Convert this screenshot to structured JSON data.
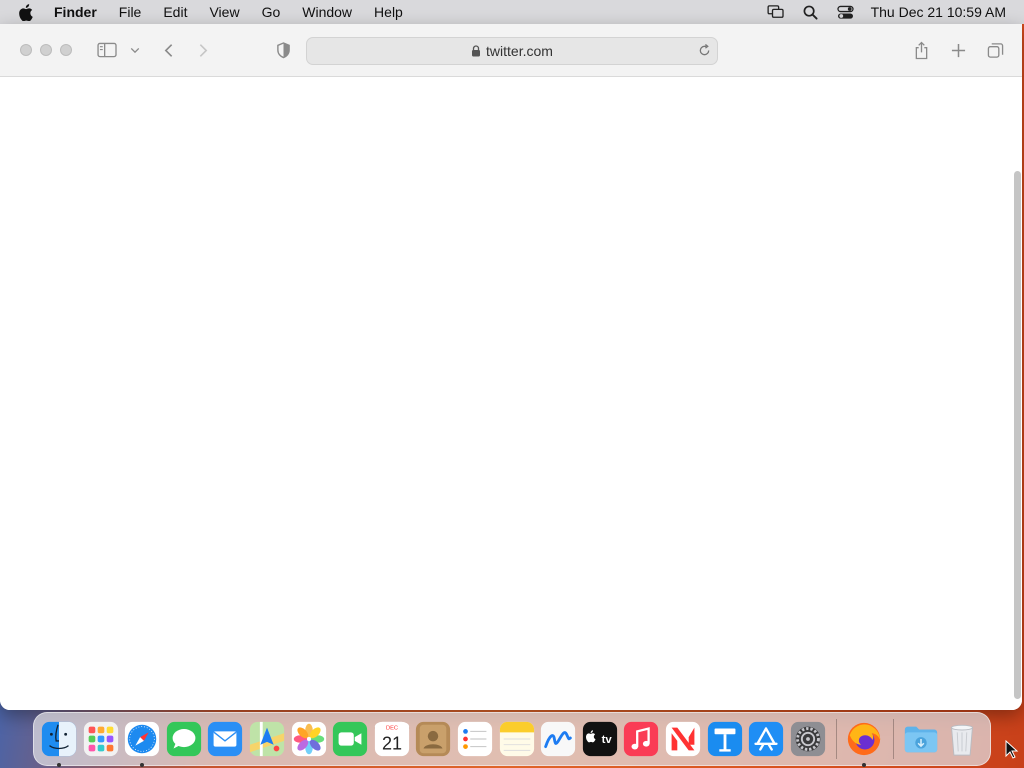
{
  "menubar": {
    "apple_icon": "apple-logo-icon",
    "items": [
      {
        "label": "Finder",
        "bold": true
      },
      {
        "label": "File"
      },
      {
        "label": "Edit"
      },
      {
        "label": "View"
      },
      {
        "label": "Go"
      },
      {
        "label": "Window"
      },
      {
        "label": "Help"
      }
    ],
    "status_icons": [
      "screen-mirroring-icon",
      "spotlight-search-icon",
      "control-center-icon"
    ],
    "clock": "Thu Dec 21  10:59 AM"
  },
  "browser": {
    "url": "twitter.com",
    "toolbar_icons": [
      "sidebar-icon",
      "chevron-down-icon",
      "back-icon",
      "forward-icon",
      "privacy-shield-icon",
      "share-icon",
      "new-tab-icon",
      "tab-overview-icon"
    ]
  },
  "dock": {
    "apps": [
      {
        "name": "Finder",
        "icon": "finder-icon",
        "running": true
      },
      {
        "name": "Launchpad",
        "icon": "launchpad-icon",
        "running": false
      },
      {
        "name": "Safari",
        "icon": "safari-icon",
        "running": true
      },
      {
        "name": "Messages",
        "icon": "messages-icon",
        "running": false
      },
      {
        "name": "Mail",
        "icon": "mail-icon",
        "running": false
      },
      {
        "name": "Maps",
        "icon": "maps-icon",
        "running": false
      },
      {
        "name": "Photos",
        "icon": "photos-icon",
        "running": false
      },
      {
        "name": "FaceTime",
        "icon": "facetime-icon",
        "running": false
      },
      {
        "name": "Calendar",
        "icon": "calendar-icon",
        "running": false,
        "month": "DEC",
        "day": "21"
      },
      {
        "name": "Contacts",
        "icon": "contacts-icon",
        "running": false
      },
      {
        "name": "Reminders",
        "icon": "reminders-icon",
        "running": false
      },
      {
        "name": "Notes",
        "icon": "notes-icon",
        "running": false
      },
      {
        "name": "Freeform",
        "icon": "freeform-icon",
        "running": false
      },
      {
        "name": "TV",
        "icon": "apple-tv-icon",
        "running": false,
        "label": "tv"
      },
      {
        "name": "Music",
        "icon": "music-icon",
        "running": false
      },
      {
        "name": "News",
        "icon": "news-icon",
        "running": false
      },
      {
        "name": "Keynote",
        "icon": "keynote-icon",
        "running": false
      },
      {
        "name": "App Store",
        "icon": "app-store-icon",
        "running": false
      },
      {
        "name": "System Settings",
        "icon": "system-settings-icon",
        "running": false
      },
      {
        "name": "Firefox",
        "icon": "firefox-icon",
        "running": true
      },
      {
        "name": "Downloads",
        "icon": "downloads-folder-icon",
        "running": false
      },
      {
        "name": "Trash",
        "icon": "trash-icon",
        "running": false
      }
    ]
  }
}
